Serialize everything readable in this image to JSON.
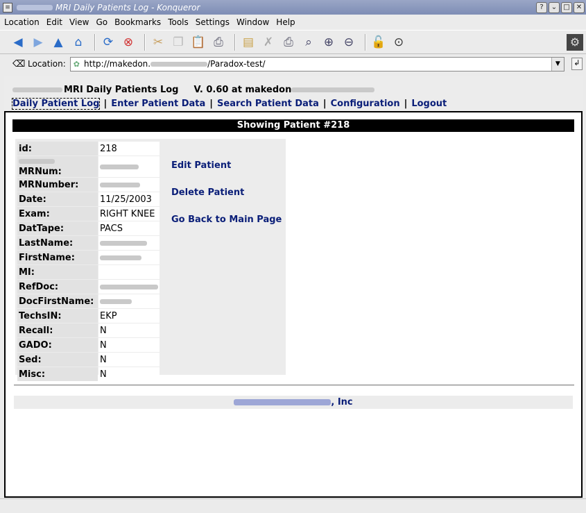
{
  "window": {
    "title": "MRI Daily Patients Log - Konqueror"
  },
  "menu": [
    "Location",
    "Edit",
    "View",
    "Go",
    "Bookmarks",
    "Tools",
    "Settings",
    "Window",
    "Help"
  ],
  "toolbar_icons": [
    "back-icon",
    "forward-icon",
    "up-icon",
    "home-icon",
    "reload-icon",
    "stop-icon",
    "cut-icon",
    "copy-icon",
    "paste-icon",
    "print-icon",
    "new-folder-icon",
    "delete-icon",
    "print-frame-icon",
    "find-icon",
    "zoom-in-icon",
    "zoom-out-icon",
    "lock-icon",
    "download-icon"
  ],
  "location": {
    "label": "Location:",
    "url_prefix": "http://makedon.",
    "url_suffix": "/Paradox-test/"
  },
  "page": {
    "app_title": "MRI Daily Patients Log",
    "version": "V. 0.60 at makedon",
    "nav": [
      "Daily Patient Log",
      "Enter Patient Data",
      "Search Patient Data",
      "Configuration",
      "Logout"
    ],
    "banner": "Showing Patient #218",
    "fields": [
      {
        "key": "id:",
        "value": "218"
      },
      {
        "key": "MRNum:",
        "value": ""
      },
      {
        "key": "MRNumber:",
        "value": ""
      },
      {
        "key": "Date:",
        "value": "11/25/2003"
      },
      {
        "key": "Exam:",
        "value": "RIGHT KNEE"
      },
      {
        "key": "DatTape:",
        "value": "PACS"
      },
      {
        "key": "LastName:",
        "value": ""
      },
      {
        "key": "FirstName:",
        "value": ""
      },
      {
        "key": "MI:",
        "value": ""
      },
      {
        "key": "RefDoc:",
        "value": ""
      },
      {
        "key": "DocFirstName:",
        "value": ""
      },
      {
        "key": "TechsIN:",
        "value": "EKP"
      },
      {
        "key": "Recall:",
        "value": "N"
      },
      {
        "key": "GADO:",
        "value": "N"
      },
      {
        "key": "Sed:",
        "value": "N"
      },
      {
        "key": "Misc:",
        "value": "N"
      }
    ],
    "actions": [
      "Edit Patient",
      "Delete Patient",
      "Go Back to Main Page"
    ],
    "footer": ", Inc"
  }
}
